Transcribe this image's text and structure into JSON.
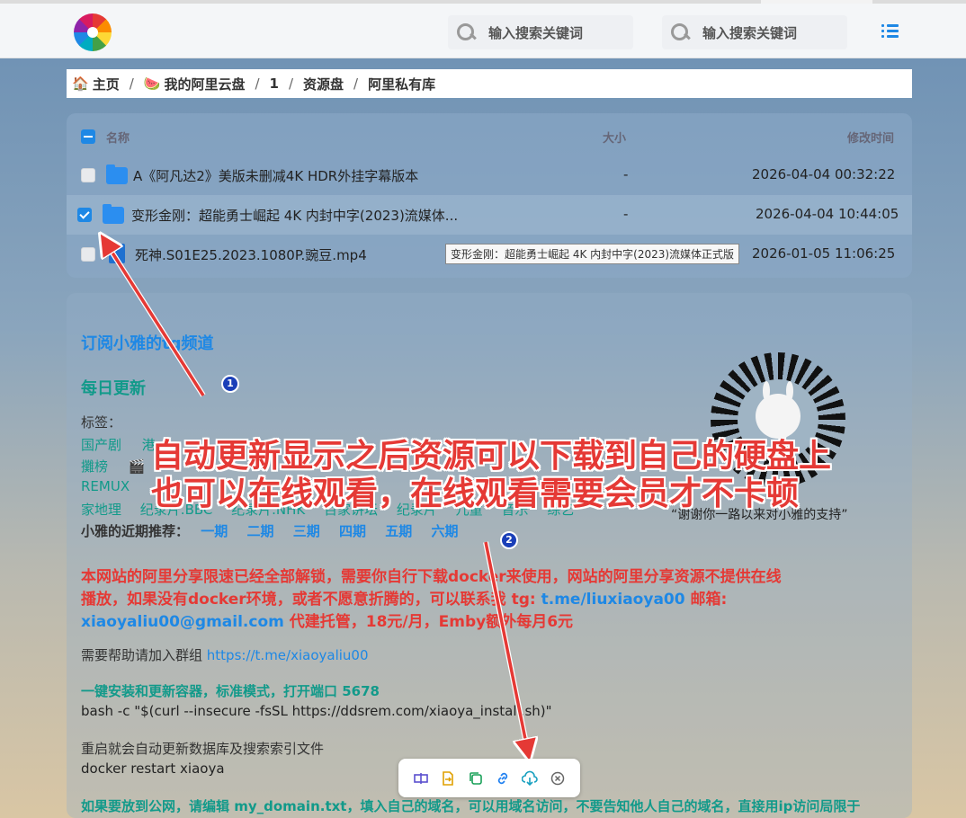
{
  "search": [
    {
      "placeholder": "输入搜索关键词"
    },
    {
      "placeholder": "输入搜索关键词"
    }
  ],
  "icons": {
    "logo": "rainbow-flower-logo",
    "search": "search-icon",
    "menu": "list-menu-icon",
    "folder": "folder-icon",
    "file": "video-file-icon"
  },
  "breadcrumb": [
    {
      "emoji": "🏠",
      "label": "主页"
    },
    {
      "emoji": "🍉",
      "label": "我的阿里云盘"
    },
    {
      "emoji": "",
      "label": "1"
    },
    {
      "emoji": "",
      "label": "资源盘"
    },
    {
      "emoji": "",
      "label": "阿里私有库"
    }
  ],
  "breadcrumb_sep": "/",
  "filelist": {
    "headers": {
      "name": "名称",
      "size": "大小",
      "modified": "修改时间"
    },
    "rows": [
      {
        "type": "folder",
        "name": "A《阿凡达2》美版未删减4K HDR外挂字幕版本",
        "size": "-",
        "modified": "2026-04-04 00:32:22",
        "checked": false
      },
      {
        "type": "folder",
        "name": "变形金刚：超能勇士崛起 4K 内封中字(2023)流媒体...",
        "size": "-",
        "modified": "2026-04-04 10:44:05",
        "checked": true
      },
      {
        "type": "file",
        "name": "死神.S01E25.2023.1080P.豌豆.mp4",
        "size": "",
        "modified": "2026-01-05 11:06:25",
        "checked": false
      }
    ],
    "tooltip": "变形金刚：超能勇士崛起  4K 内封中字(2023)流媒体正式版"
  },
  "readme": {
    "subscribe": "订阅小雅的tg频道",
    "daily": "每日更新",
    "tags_label": "标签：",
    "tags_row1": [
      "国产剧",
      "港"
    ],
    "tags_row2": [
      "攤榜",
      "🎬"
    ],
    "tags_row3": [
      "REMUX"
    ],
    "tags_row4": [
      "家地理",
      "纪录片.BBC",
      "纪录片.NHK",
      "百家讲坛",
      "纪录片",
      "儿童",
      "音乐",
      "综艺"
    ],
    "recent_label": "小雅的近期推荐：",
    "recent": [
      "一期",
      "二期",
      "三期",
      "四期",
      "五期",
      "六期"
    ],
    "notice_line1": "本网站的阿里分享限速已经全部解锁，需要你自行下载docker来使用，网站的阿里分享资源不提供在线",
    "notice_line2a": "播放，如果没有docker环境，或者不愿意折腾的，可以联系我 tg: ",
    "notice_tg": "t.me/liuxiaoya00",
    "notice_line2b": " 邮箱:",
    "notice_email": "xiaoyaliu00@gmail.com",
    "notice_line3": " 代建托管，18元/月，Emby额外每月6元",
    "help": "需要帮助请加入群组 ",
    "help_link": "https://t.me/xiaoyaliu00",
    "install_title": "一键安装和更新容器，标准模式，打开端口 5678",
    "install_cmd": "bash -c \"$(curl --insecure -fsSL https://ddsrem.com/xiaoya_install.sh)\"",
    "restart_title": "重启就会自动更新数据库及搜索索引文件",
    "restart_cmd": "docker restart xiaoya",
    "public": "如果要放到公网，请编辑 my_domain.txt，填入自己的域名，可以用域名访问，不要告知他人自己的域名，直接用ip访问局限于",
    "thanks": "“谢谢你一路以来对小雅的支持”"
  },
  "annotation": {
    "line1": "自动更新显示之后资源可以下载到自己的硬盘上",
    "line2": "也可以在线观看，在线观看需要会员才不卡顿",
    "badge1": "1",
    "badge2": "2"
  },
  "toolbar": [
    "rename-icon",
    "move-icon",
    "copy-icon",
    "link-icon",
    "cloud-download-icon",
    "cancel-icon"
  ],
  "colors": {
    "accent": "#1e88e5",
    "teal": "#129a8a",
    "red": "#e53935"
  }
}
